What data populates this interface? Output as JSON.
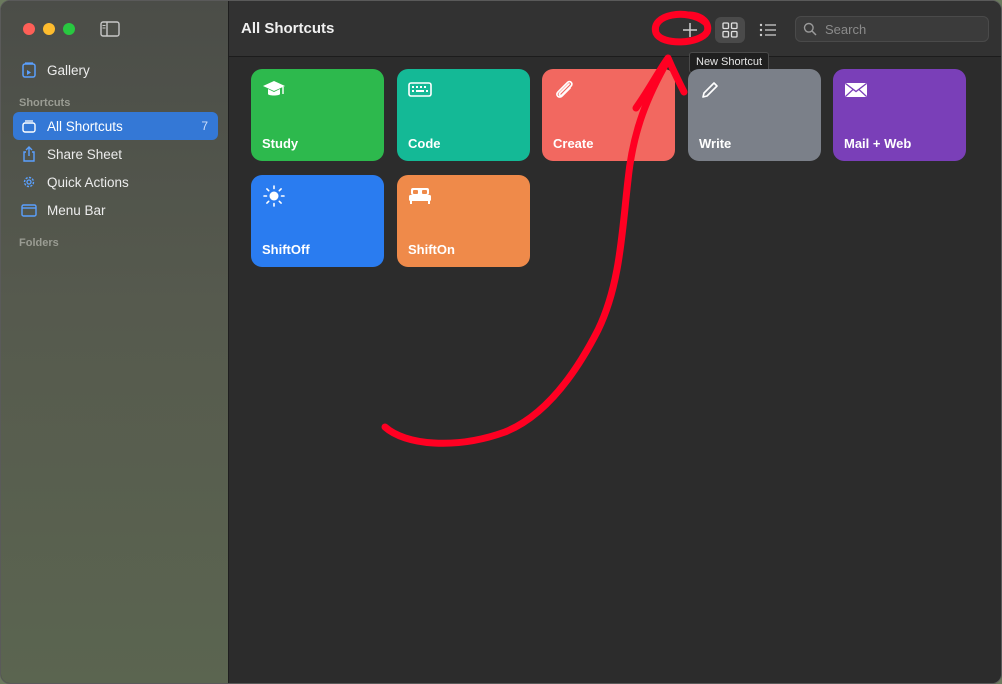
{
  "sidebar": {
    "items": [
      {
        "label": "Gallery"
      },
      {
        "label": "All Shortcuts",
        "count": "7"
      },
      {
        "label": "Share Sheet"
      },
      {
        "label": "Quick Actions"
      },
      {
        "label": "Menu Bar"
      }
    ],
    "sections": {
      "shortcuts": "Shortcuts",
      "folders": "Folders"
    }
  },
  "toolbar": {
    "title": "All Shortcuts",
    "new_shortcut_icon": "plus-icon",
    "grid_view_icon": "grid-icon",
    "list_view_icon": "list-icon",
    "search_placeholder": "Search",
    "tooltip": "New Shortcut"
  },
  "tiles": [
    {
      "label": "Study",
      "icon": "graduation-cap-icon",
      "color": "#2db94d"
    },
    {
      "label": "Code",
      "icon": "keyboard-icon",
      "color": "#14b996"
    },
    {
      "label": "Create",
      "icon": "paperclip-icon",
      "color": "#f26860"
    },
    {
      "label": "Write",
      "icon": "pencil-icon",
      "color": "#7b8089"
    },
    {
      "label": "Mail + Web",
      "icon": "envelope-icon",
      "color": "#7a3fb8"
    },
    {
      "label": "ShiftOff",
      "icon": "sun-icon",
      "color": "#2a7cf0"
    },
    {
      "label": "ShiftOn",
      "icon": "bed-icon",
      "color": "#ef8a4a"
    }
  ],
  "colors": {
    "accent": "#3478d6",
    "annotation": "#ff0022"
  }
}
